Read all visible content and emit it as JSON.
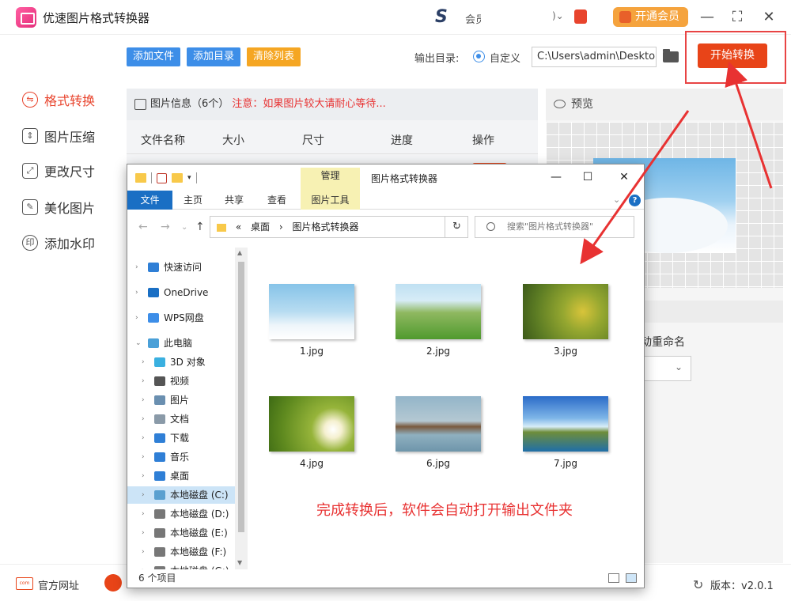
{
  "app": {
    "title": "优速图片格式转换器",
    "member_text": "会员",
    "vip_label": "开通会员",
    "min_icon": "—",
    "max_icon": "⛶",
    "close_icon": "✕"
  },
  "sidebar": {
    "items": [
      {
        "label": "格式转换",
        "active": true,
        "icon": "convert-icon"
      },
      {
        "label": "图片压缩",
        "active": false,
        "icon": "compress-icon"
      },
      {
        "label": "更改尺寸",
        "active": false,
        "icon": "resize-icon"
      },
      {
        "label": "美化图片",
        "active": false,
        "icon": "beautify-icon"
      },
      {
        "label": "添加水印",
        "active": false,
        "icon": "watermark-icon"
      }
    ]
  },
  "toolbar": {
    "add_files": "添加文件",
    "add_dir": "添加目录",
    "clear_list": "清除列表",
    "output_label": "输出目录:",
    "radio_label": "自定义",
    "output_path": "C:\\Users\\admin\\Desktop",
    "start_label": "开始转换"
  },
  "file_panel": {
    "info_label": "图片信息（6个）",
    "warning": "注意：如果图片较大请耐心等待...",
    "columns": [
      "文件名称",
      "大小",
      "尺寸",
      "进度",
      "操作"
    ]
  },
  "preview": {
    "title": "预览",
    "rename_label": "动重命名"
  },
  "explorer": {
    "manage_tab": "管理",
    "title": "图片格式转换器",
    "ribbon_tabs": [
      "文件",
      "主页",
      "共享",
      "查看",
      "图片工具"
    ],
    "help_icon": "?",
    "address": [
      "«",
      "桌面",
      "›",
      "图片格式转换器"
    ],
    "search_placeholder": "搜索\"图片格式转换器\"",
    "tree": [
      {
        "label": "快速访问",
        "icon": "quick-access-icon",
        "color": "#2f7fd6",
        "level": 0
      },
      {
        "label": "OneDrive",
        "icon": "onedrive-icon",
        "color": "#1a6fc4",
        "level": 0
      },
      {
        "label": "WPS网盘",
        "icon": "wps-cloud-icon",
        "color": "#3d8ee8",
        "level": 0
      },
      {
        "label": "此电脑",
        "icon": "this-pc-icon",
        "color": "#4aa0d8",
        "level": 0,
        "expanded": true
      },
      {
        "label": "3D 对象",
        "icon": "3d-objects-icon",
        "color": "#3ab0e0",
        "level": 1
      },
      {
        "label": "视频",
        "icon": "videos-icon",
        "color": "#555",
        "level": 1
      },
      {
        "label": "图片",
        "icon": "pictures-icon",
        "color": "#6a8fb0",
        "level": 1
      },
      {
        "label": "文档",
        "icon": "documents-icon",
        "color": "#8a9aa8",
        "level": 1
      },
      {
        "label": "下载",
        "icon": "downloads-icon",
        "color": "#2f7fd6",
        "level": 1
      },
      {
        "label": "音乐",
        "icon": "music-icon",
        "color": "#2f7fd6",
        "level": 1
      },
      {
        "label": "桌面",
        "icon": "desktop-icon",
        "color": "#2f7fd6",
        "level": 1
      },
      {
        "label": "本地磁盘 (C:)",
        "icon": "drive-c-icon",
        "color": "#5aa0d0",
        "level": 1,
        "selected": true
      },
      {
        "label": "本地磁盘 (D:)",
        "icon": "drive-d-icon",
        "color": "#777",
        "level": 1
      },
      {
        "label": "本地磁盘 (E:)",
        "icon": "drive-e-icon",
        "color": "#777",
        "level": 1
      },
      {
        "label": "本地磁盘 (F:)",
        "icon": "drive-f-icon",
        "color": "#777",
        "level": 1
      },
      {
        "label": "本地磁盘 (G:)",
        "icon": "drive-g-icon",
        "color": "#777",
        "level": 1
      }
    ],
    "files": [
      {
        "name": "1.jpg",
        "thumb": "sky-clouds"
      },
      {
        "name": "2.jpg",
        "thumb": "green-meadow"
      },
      {
        "name": "3.jpg",
        "thumb": "yellow-flowers"
      },
      {
        "name": "4.jpg",
        "thumb": "daisies"
      },
      {
        "name": "6.jpg",
        "thumb": "lake-house"
      },
      {
        "name": "7.jpg",
        "thumb": "harbor"
      }
    ],
    "caption": "完成转换后，软件会自动打开输出文件夹",
    "status": "6 个项目"
  },
  "bottom": {
    "site_label": "官方网址",
    "site_icon_text": "com",
    "version": "版本：v2.0.1"
  },
  "colors": {
    "accent": "#e84418",
    "blue": "#3d8ee8",
    "orange": "#f5a623",
    "annotation_red": "#e83232"
  }
}
